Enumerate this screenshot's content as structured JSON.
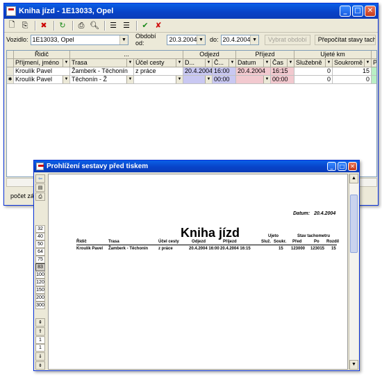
{
  "main": {
    "title": "Kniha jízd - 1E13033, Opel",
    "filter": {
      "vehicle_label": "Vozidlo:",
      "vehicle_value": "1E13033, Opel",
      "period_from_label": "Období od:",
      "period_from_value": "20.3.2004",
      "period_to_label": "do:",
      "period_to_value": "20.4.2004",
      "select_period_button": "Vybrat období",
      "recalc_button": "Přepočítat stavy tachom"
    },
    "grid": {
      "group_headers": [
        "Řidič",
        "...",
        "Odjezd",
        "Příjezd",
        "Ujeté km"
      ],
      "columns": [
        "Příjmení, jméno",
        "Trasa",
        "Účel cesty",
        "D...",
        "Č...",
        "Datum",
        "Čas",
        "Služebně",
        "Soukromě",
        "P"
      ],
      "rows": [
        {
          "driver": "Kroulík Pavel",
          "route": "Žamberk - Těchonín",
          "purpose": "z práce",
          "dep_date": "20.4.2004",
          "dep_time": "16:00",
          "arr_date": "20.4.2004",
          "arr_time": "16:15",
          "business": "0",
          "private": "15"
        },
        {
          "driver": "Kroulík Pavel",
          "route": "Těchonín - Ž",
          "purpose": "",
          "dep_date": "",
          "dep_time": "00:00",
          "arr_date": "",
          "arr_time": "00:00",
          "business": "0",
          "private": "0"
        }
      ]
    },
    "status_text": "počet zá"
  },
  "preview": {
    "title": "Prohlížení sestavy před tiskem",
    "zoom_levels": [
      "32",
      "40",
      "50",
      "64",
      "75",
      "83",
      "100",
      "120",
      "150",
      "200",
      "300"
    ],
    "selected_zoom": "83",
    "page_buttons": [
      "1",
      "1"
    ],
    "report": {
      "date_label": "Datum:",
      "date_value": "20.4.2004",
      "title": "Kniha jízd",
      "headers": {
        "driver": "Řidič",
        "route": "Trasa",
        "purpose": "Účel cesty",
        "departure": "Odjezd",
        "arrival": "Příjezd",
        "driven": "Ujeto",
        "business": "Služ.",
        "private": "Soukr.",
        "tacho": "Stav tachometru",
        "before": "Před",
        "after": "Po",
        "diff": "Rozdíl"
      },
      "row": {
        "driver": "Kroulík Pavel",
        "route": "Žamberk - Těchonín",
        "purpose": "z práce",
        "departure": "20.4.2004 16:00",
        "arrival": "20.4.2004 16:15",
        "business": "",
        "private": "15",
        "before": "123000",
        "after": "123015",
        "diff": "15"
      }
    }
  },
  "colors": {
    "titlebar": "#0a5fe6",
    "departure_highlight": "#c9c8f2",
    "arrival_highlight": "#f2c9cf",
    "extra_column": "#b9efc4"
  }
}
